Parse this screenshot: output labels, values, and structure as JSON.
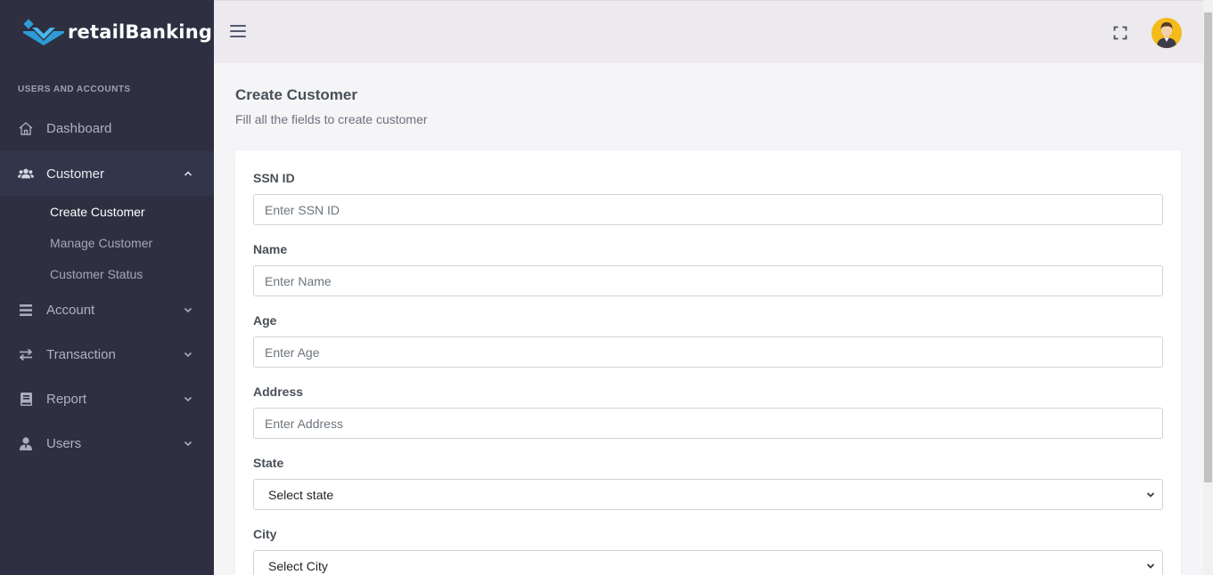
{
  "brand": {
    "name": "retailBanking"
  },
  "sidebar": {
    "section_label": "USERS AND ACCOUNTS",
    "items": [
      {
        "label": "Dashboard",
        "icon": "home-icon"
      },
      {
        "label": "Customer",
        "icon": "users-icon",
        "expanded": true,
        "children": [
          {
            "label": "Create Customer",
            "current": true
          },
          {
            "label": "Manage Customer"
          },
          {
            "label": "Customer Status"
          }
        ]
      },
      {
        "label": "Account",
        "icon": "list-icon"
      },
      {
        "label": "Transaction",
        "icon": "exchange-icon"
      },
      {
        "label": "Report",
        "icon": "book-icon"
      },
      {
        "label": "Users",
        "icon": "user-tie-icon"
      }
    ]
  },
  "header": {
    "menu_icon": "hamburger-icon",
    "fullscreen_icon": "fullscreen-icon",
    "avatar_icon": "user-avatar"
  },
  "page": {
    "title": "Create Customer",
    "subtitle": "Fill all the fields to create customer"
  },
  "form": {
    "ssn": {
      "label": "SSN ID",
      "placeholder": "Enter SSN ID",
      "value": ""
    },
    "name": {
      "label": "Name",
      "placeholder": "Enter Name",
      "value": ""
    },
    "age": {
      "label": "Age",
      "placeholder": "Enter Age",
      "value": ""
    },
    "address": {
      "label": "Address",
      "placeholder": "Enter Address",
      "value": ""
    },
    "state": {
      "label": "State",
      "selected": "Select state"
    },
    "city": {
      "label": "City",
      "selected": "Select City"
    }
  },
  "colors": {
    "sidebar_bg": "#2e3042",
    "active_item_bg": "#33364a",
    "brand_blue": "#2e9bd6",
    "avatar_bg": "#f4bc1b"
  }
}
